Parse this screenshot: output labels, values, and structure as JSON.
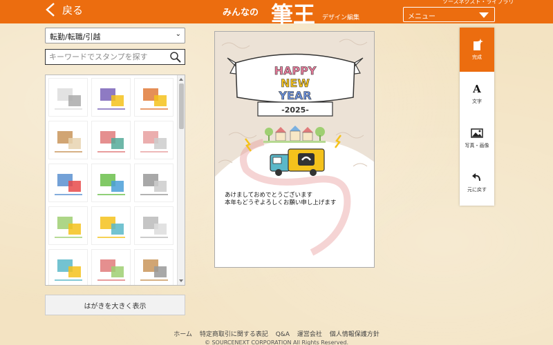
{
  "header": {
    "back_label": "戻る",
    "logo_small": "みんなの",
    "logo_big": "筆王",
    "logo_sub": "デザイン編集",
    "top_right_text": "ソースネクスト・ライブラリ",
    "menu_label": "メニュー"
  },
  "sidebar": {
    "category_value": "転勤/転職/引越",
    "search_placeholder": "キーワードでスタンプを探す",
    "stamps": [
      {
        "icon": "stamp-text-notice"
      },
      {
        "icon": "stamp-boxes"
      },
      {
        "icon": "stamp-house-roof"
      },
      {
        "icon": "stamp-house-illustration"
      },
      {
        "icon": "stamp-truck-flowers"
      },
      {
        "icon": "stamp-line-houses"
      },
      {
        "icon": "stamp-signboard-bird"
      },
      {
        "icon": "stamp-green-drawer"
      },
      {
        "icon": "stamp-address-card"
      },
      {
        "icon": "stamp-town-row"
      },
      {
        "icon": "stamp-delivery-truck"
      },
      {
        "icon": "stamp-small-text"
      },
      {
        "icon": "stamp-truck-building"
      },
      {
        "icon": "stamp-flower-bag"
      },
      {
        "icon": "stamp-vertical-text"
      }
    ],
    "enlarge_label": "はがきを大きく表示"
  },
  "card": {
    "banner_line1": "HAPPY",
    "banner_line2": "NEW",
    "banner_line3": "YEAR",
    "year": "-2025-",
    "message_line1": "あけましておめでとうございます",
    "message_line2": "本年もどうぞよろしくお願い申し上げます",
    "colors": {
      "accent": "#ec6d0f",
      "truck": "#f4c21c",
      "cab": "#5bb8c9"
    }
  },
  "tools": [
    {
      "label": "完成",
      "icon": "sparkle-card-icon",
      "active": true
    },
    {
      "label": "文字",
      "icon": "text-a-icon",
      "active": false
    },
    {
      "label": "写真・画像",
      "icon": "image-icon",
      "active": false
    },
    {
      "label": "元に戻す",
      "icon": "undo-icon",
      "active": false
    }
  ],
  "footer": {
    "links": [
      "ホーム",
      "特定商取引に関する表記",
      "Q&A",
      "運営会社",
      "個人情報保護方針"
    ],
    "copyright": "© SOURCENEXT CORPORATION All Rights Reserved."
  }
}
